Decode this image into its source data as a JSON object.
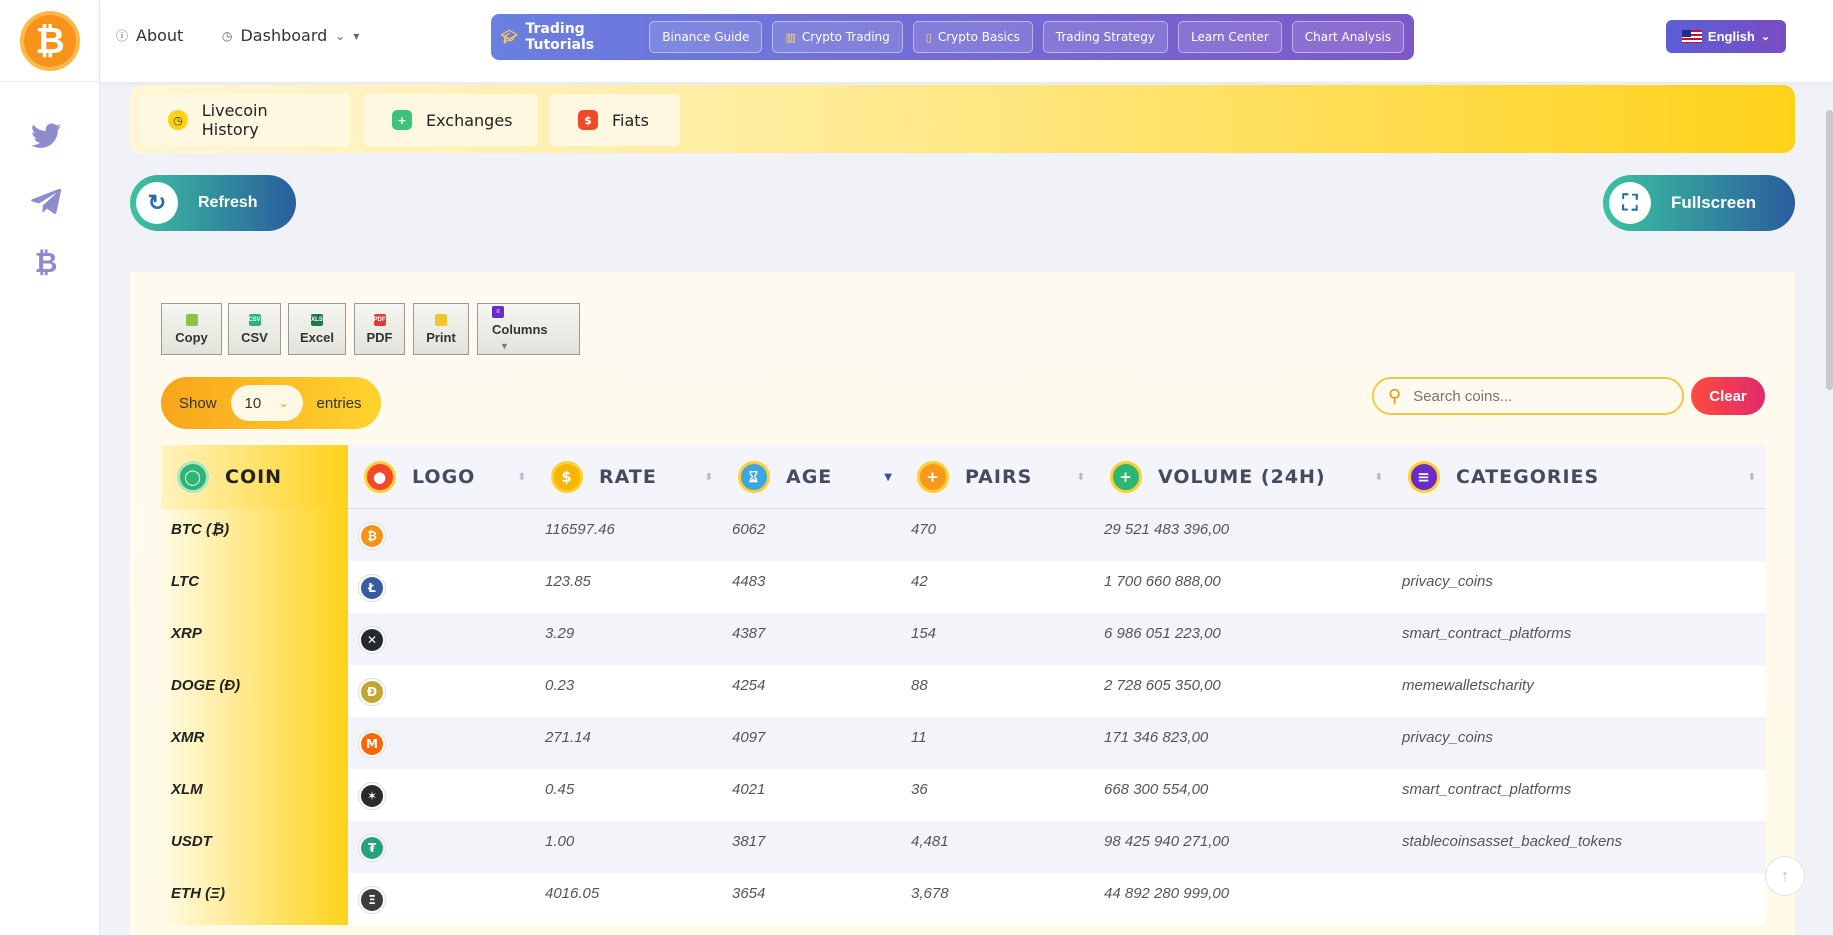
{
  "nav": {
    "about": "About",
    "dashboard": "Dashboard",
    "tutorials_title": "Trading Tutorials",
    "tutorials": [
      "Binance Guide",
      "Crypto Trading",
      "Crypto Basics",
      "Trading Strategy",
      "Learn Center",
      "Chart Analysis"
    ],
    "language": "English"
  },
  "tabs": [
    "Livecoin History",
    "Exchanges",
    "Fiats"
  ],
  "actions": {
    "refresh": "Refresh",
    "fullscreen": "Fullscreen"
  },
  "export": [
    "Copy",
    "CSV",
    "Excel",
    "PDF",
    "Print",
    "Columns"
  ],
  "length": {
    "show": "Show",
    "value": "10",
    "entries": "entries"
  },
  "search": {
    "placeholder": "Search coins...",
    "clear": "Clear"
  },
  "table": {
    "headers": [
      "COIN",
      "LOGO",
      "RATE",
      "AGE",
      "PAIRS",
      "VOLUME (24H)",
      "CATEGORIES"
    ],
    "rows": [
      {
        "coin": "BTC (₿)",
        "rate": "116597.46",
        "age": "6062",
        "pairs": "470",
        "volume": "29 521 483 396,00",
        "categories": "",
        "logo_color": "#f7931a",
        "logo_glyph": "₿"
      },
      {
        "coin": "LTC",
        "rate": "123.85",
        "age": "4483",
        "pairs": "42",
        "volume": "1 700 660 888,00",
        "categories": "privacy_coins",
        "logo_color": "#345d9d",
        "logo_glyph": "Ł"
      },
      {
        "coin": "XRP",
        "rate": "3.29",
        "age": "4387",
        "pairs": "154",
        "volume": "6 986 051 223,00",
        "categories": "smart_contract_platforms",
        "logo_color": "#23292f",
        "logo_glyph": "✕"
      },
      {
        "coin": "DOGE (Ð)",
        "rate": "0.23",
        "age": "4254",
        "pairs": "88",
        "volume": "2 728 605 350,00",
        "categories": "memewalletscharity",
        "logo_color": "#c2a633",
        "logo_glyph": "Ð"
      },
      {
        "coin": "XMR",
        "rate": "271.14",
        "age": "4097",
        "pairs": "11",
        "volume": "171 346 823,00",
        "categories": "privacy_coins",
        "logo_color": "#ff6600",
        "logo_glyph": "M"
      },
      {
        "coin": "XLM",
        "rate": "0.45",
        "age": "4021",
        "pairs": "36",
        "volume": "668 300 554,00",
        "categories": "smart_contract_platforms",
        "logo_color": "#2b2b2b",
        "logo_glyph": "✶"
      },
      {
        "coin": "USDT",
        "rate": "1.00",
        "age": "3817",
        "pairs": "4,481",
        "volume": "98 425 940 271,00",
        "categories": "stablecoinsasset_backed_tokens",
        "logo_color": "#26a17b",
        "logo_glyph": "₮"
      },
      {
        "coin": "ETH (Ξ)",
        "rate": "4016.05",
        "age": "3654",
        "pairs": "3,678",
        "volume": "44 892 280 999,00",
        "categories": "",
        "logo_color": "#3c3c3d",
        "logo_glyph": "Ξ"
      }
    ]
  }
}
